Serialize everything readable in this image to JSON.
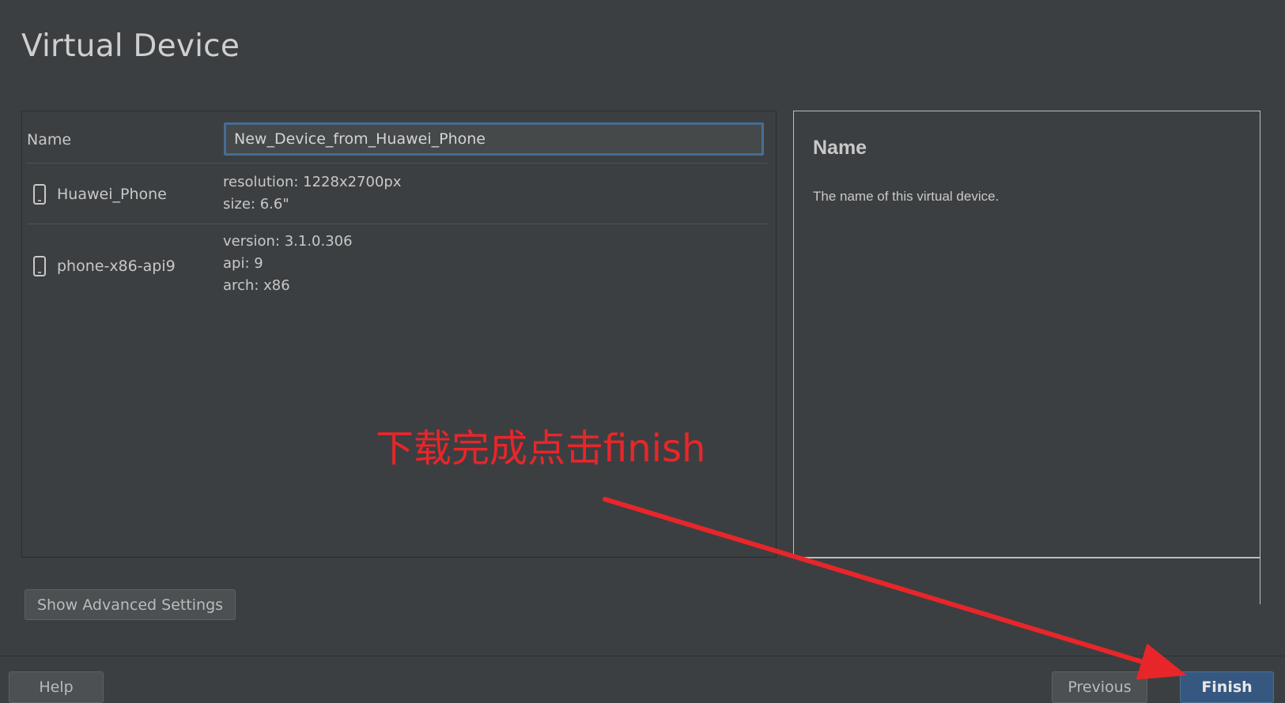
{
  "page": {
    "title": "Virtual Device"
  },
  "form": {
    "name_label": "Name",
    "name_value": "New_Device_from_Huawei_Phone",
    "devices": [
      {
        "icon": "phone-icon",
        "name": "Huawei_Phone",
        "details": [
          "resolution: 1228x2700px",
          "size: 6.6\""
        ]
      },
      {
        "icon": "phone-icon",
        "name": "phone-x86-api9",
        "details": [
          "version: 3.1.0.306",
          "api: 9",
          "arch: x86"
        ]
      }
    ]
  },
  "help": {
    "title": "Name",
    "text": "The name of this virtual device."
  },
  "buttons": {
    "advanced": "Show Advanced Settings",
    "help": "Help",
    "previous": "Previous",
    "finish": "Finish"
  },
  "annotation": {
    "text": "下载完成点击finish",
    "color": "#e8262a"
  },
  "colors": {
    "background": "#3c3f41",
    "accent_border": "#466d94",
    "primary_button": "#365880"
  }
}
